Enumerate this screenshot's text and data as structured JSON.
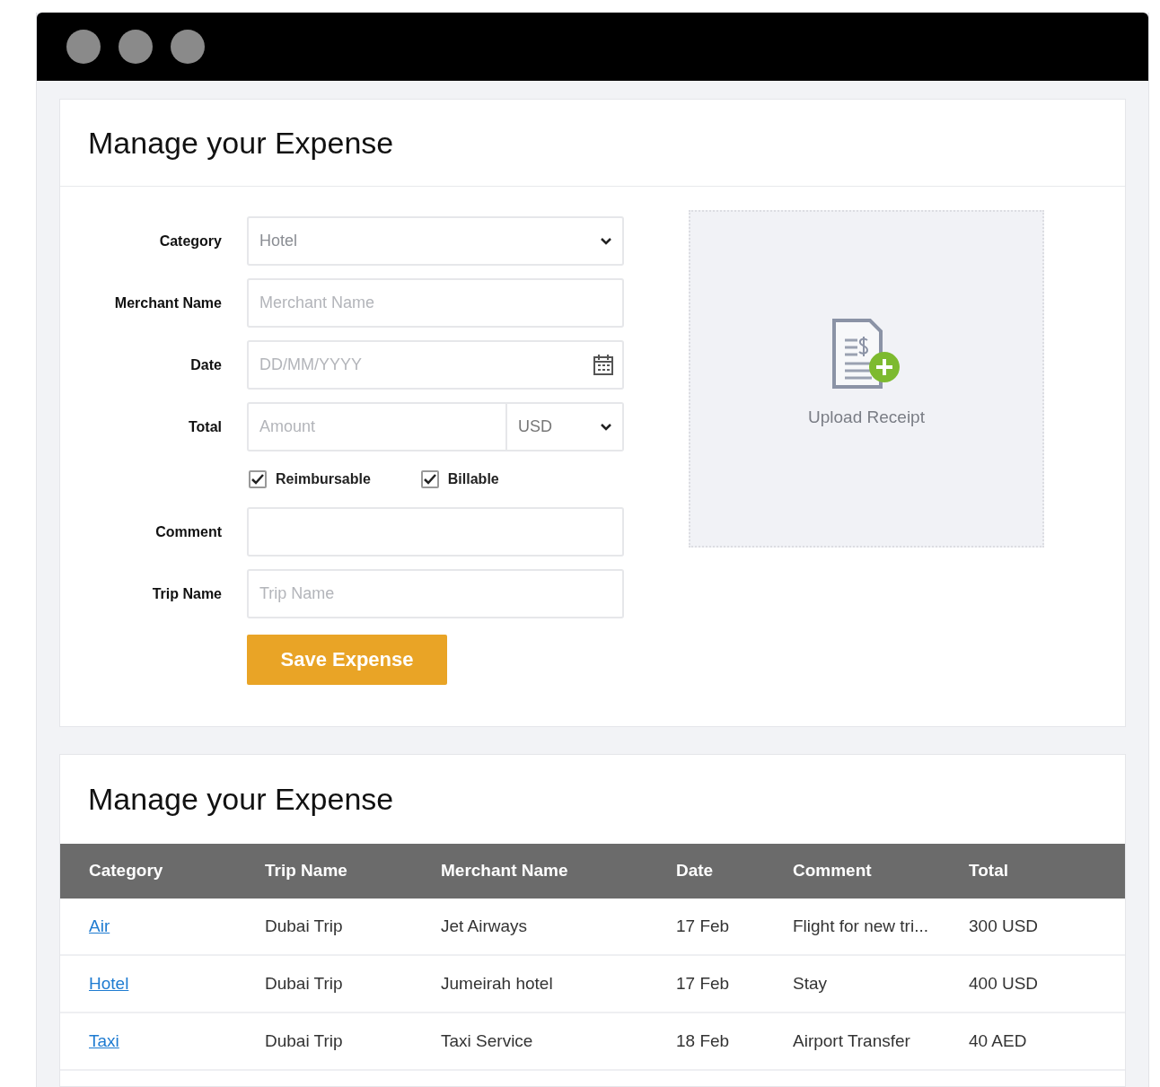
{
  "form_card": {
    "title": "Manage your Expense",
    "fields": [
      {
        "kind": "select",
        "label": "Category",
        "value": "Hotel"
      },
      {
        "kind": "text",
        "label": "Merchant Name",
        "placeholder": "Merchant Name"
      },
      {
        "kind": "date",
        "label": "Date",
        "placeholder": "DD/MM/YYYY"
      },
      {
        "kind": "amount",
        "label": "Total",
        "placeholder": "Amount",
        "currency": "USD"
      },
      {
        "kind": "checks",
        "options": [
          {
            "label": "Reimbursable",
            "checked": true
          },
          {
            "label": "Billable",
            "checked": true
          }
        ]
      },
      {
        "kind": "text",
        "label": "Comment"
      },
      {
        "kind": "text",
        "label": "Trip Name",
        "placeholder": "Trip Name"
      }
    ],
    "save_button": "Save Expense",
    "upload": {
      "label": "Upload Receipt"
    }
  },
  "table_card": {
    "title": "Manage your Expense",
    "columns": [
      "Category",
      "Trip Name",
      "Merchant Name",
      "Date",
      "Comment",
      "Total"
    ],
    "rows": [
      [
        "Air",
        "Dubai Trip",
        "Jet Airways",
        "17 Feb",
        "Flight for new tri...",
        "300 USD"
      ],
      [
        "Hotel",
        "Dubai Trip",
        "Jumeirah hotel",
        "17 Feb",
        "Stay",
        "400 USD"
      ],
      [
        "Taxi",
        "Dubai Trip",
        "Taxi Service",
        "18 Feb",
        "Airport Transfer",
        "40 AED"
      ]
    ]
  }
}
